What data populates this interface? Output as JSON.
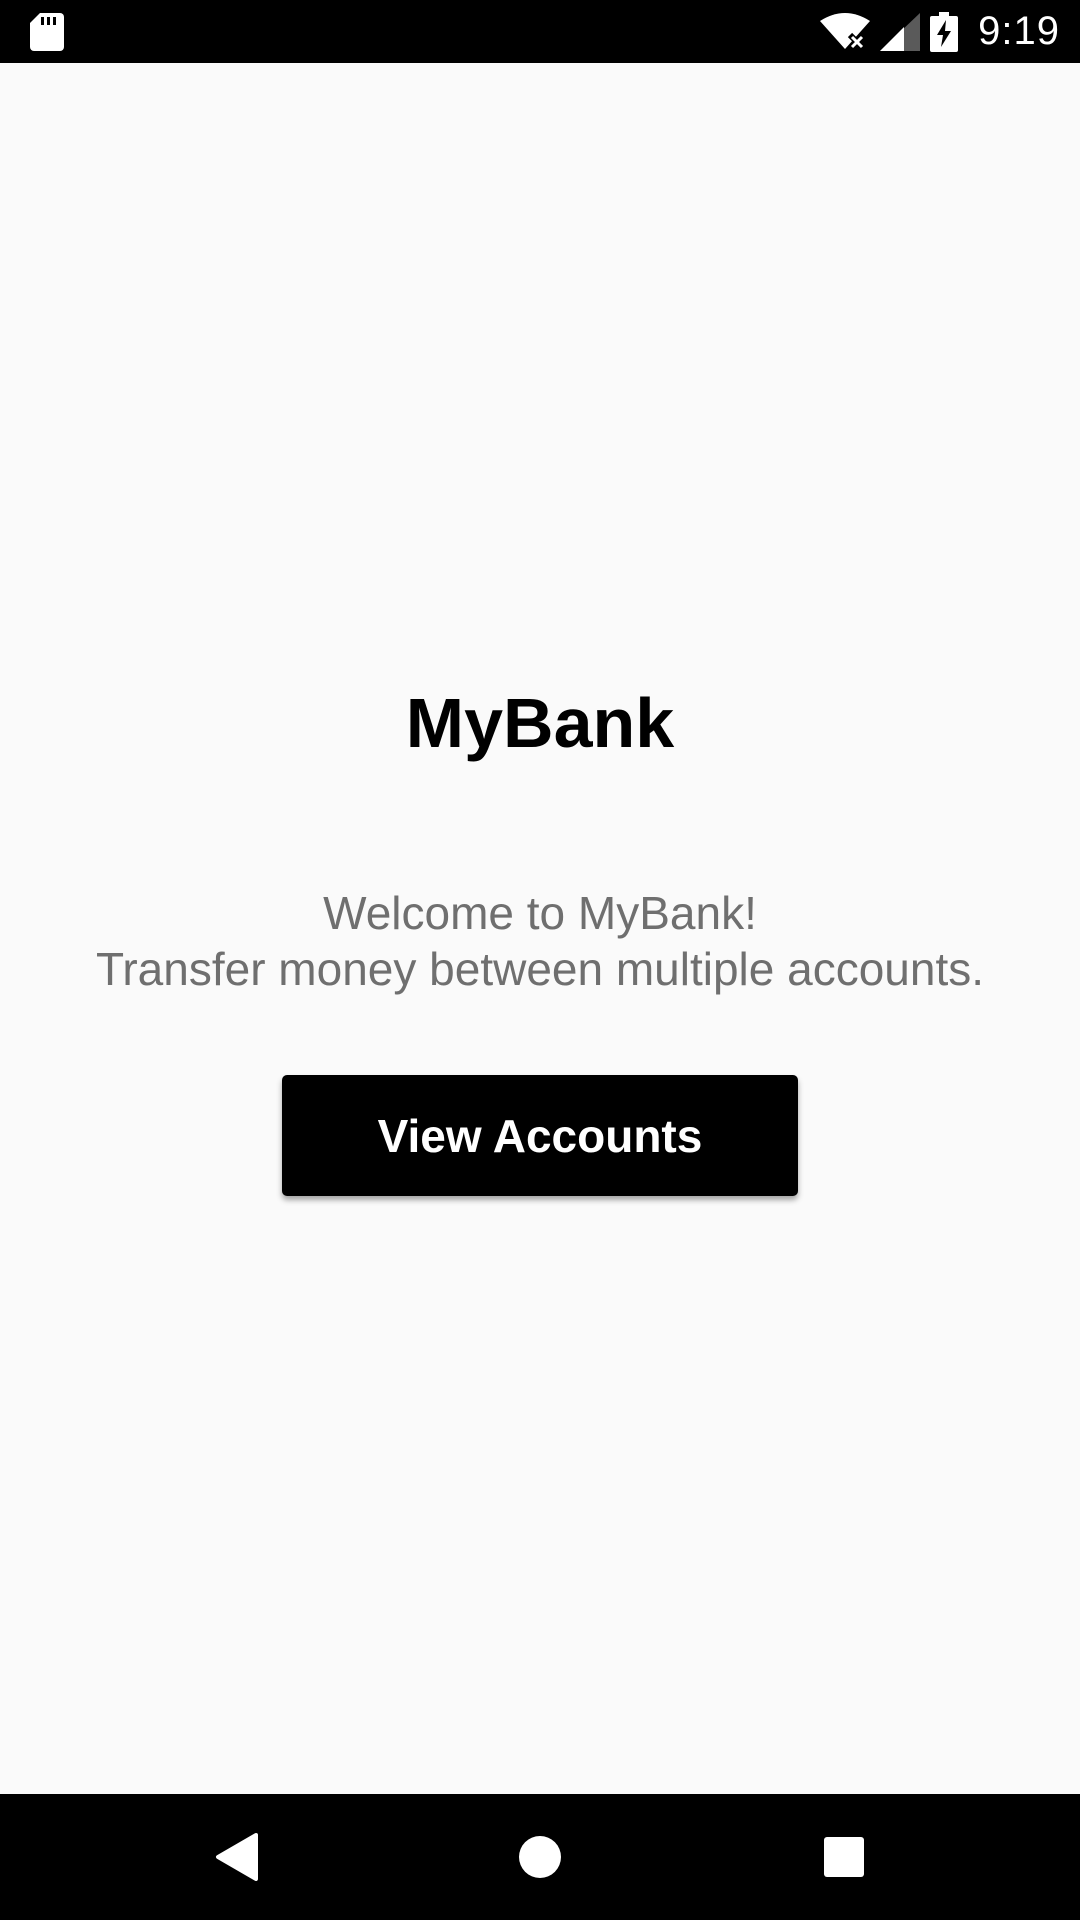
{
  "status_bar": {
    "time": "9:19",
    "icons": [
      "sd-card-icon",
      "wifi-off-icon",
      "signal-icon",
      "battery-charging-icon"
    ]
  },
  "main": {
    "title": "MyBank",
    "welcome_line1": "Welcome to MyBank!",
    "welcome_line2": "Transfer money between multiple accounts.",
    "view_accounts_label": "View Accounts"
  },
  "nav_bar": {
    "buttons": [
      "back-icon",
      "home-icon",
      "recents-icon"
    ]
  },
  "colors": {
    "background": "#fafafa",
    "bars": "#000000",
    "button": "#000000",
    "button_text": "#ffffff",
    "subtitle": "#6f6f6f"
  }
}
